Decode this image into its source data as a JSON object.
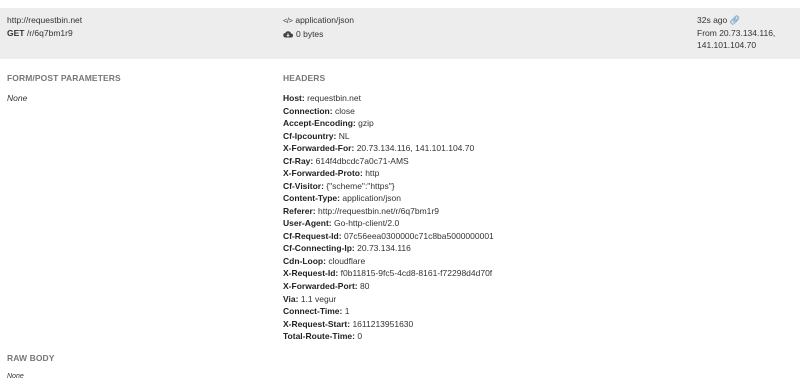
{
  "summary": {
    "url": "http://requestbin.net",
    "method": "GET",
    "path": "/r/6q7bm1r9",
    "content_type": "application/json",
    "size": "0 bytes",
    "time_ago": "32s ago",
    "from_line1": "From 20.73.134.116,",
    "from_line2": "141.101.104.70",
    "icons": [
      "code-icon",
      "cloud-icon",
      "link-icon"
    ]
  },
  "form": {
    "title": "FORM/POST PARAMETERS",
    "value": "None"
  },
  "headers": {
    "title": "HEADERS",
    "items": [
      {
        "key": "Host:",
        "value": "requestbin.net"
      },
      {
        "key": "Connection:",
        "value": "close"
      },
      {
        "key": "Accept-Encoding:",
        "value": "gzip"
      },
      {
        "key": "Cf-Ipcountry:",
        "value": "NL"
      },
      {
        "key": "X-Forwarded-For:",
        "value": "20.73.134.116, 141.101.104.70"
      },
      {
        "key": "Cf-Ray:",
        "value": "614f4dbcdc7a0c71-AMS"
      },
      {
        "key": "X-Forwarded-Proto:",
        "value": "http"
      },
      {
        "key": "Cf-Visitor:",
        "value": "{\"scheme\":\"https\"}"
      },
      {
        "key": "Content-Type:",
        "value": "application/json"
      },
      {
        "key": "Referer:",
        "value": "http://requestbin.net/r/6q7bm1r9"
      },
      {
        "key": "User-Agent:",
        "value": "Go-http-client/2.0"
      },
      {
        "key": "Cf-Request-Id:",
        "value": "07c56eea0300000c71c8ba5000000001"
      },
      {
        "key": "Cf-Connecting-Ip:",
        "value": "20.73.134.116"
      },
      {
        "key": "Cdn-Loop:",
        "value": "cloudflare"
      },
      {
        "key": "X-Request-Id:",
        "value": "f0b11815-9fc5-4cd8-8161-f72298d4d70f"
      },
      {
        "key": "X-Forwarded-Port:",
        "value": "80"
      },
      {
        "key": "Via:",
        "value": "1.1 vegur"
      },
      {
        "key": "Connect-Time:",
        "value": "1"
      },
      {
        "key": "X-Request-Start:",
        "value": "1611213951630"
      },
      {
        "key": "Total-Route-Time:",
        "value": "0"
      }
    ]
  },
  "raw_body": {
    "title": "RAW BODY",
    "value": "None"
  }
}
